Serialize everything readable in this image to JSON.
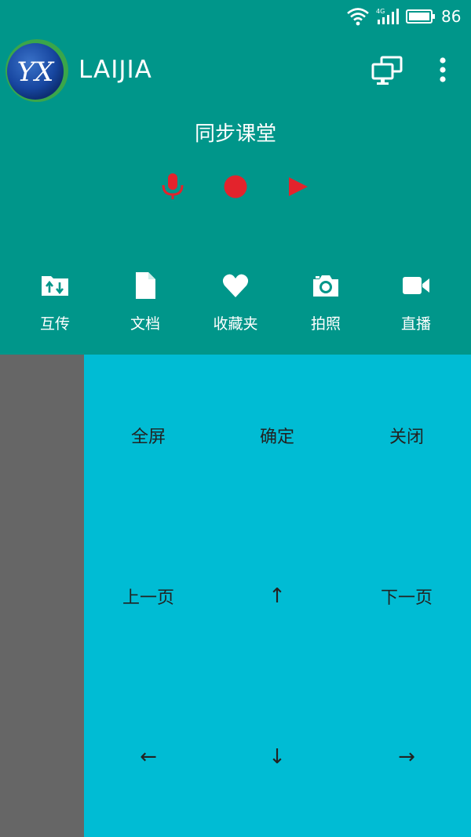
{
  "status_bar": {
    "battery_text": "86",
    "network_label": "4G"
  },
  "app_bar": {
    "title": "LAIJIA",
    "logo_text": "YX"
  },
  "classroom": {
    "title": "同步课堂"
  },
  "toolbar": {
    "items": [
      {
        "label": "互传",
        "icon": "transfer-folder-icon"
      },
      {
        "label": "文档",
        "icon": "document-icon"
      },
      {
        "label": "收藏夹",
        "icon": "heart-icon"
      },
      {
        "label": "拍照",
        "icon": "camera-icon"
      },
      {
        "label": "直播",
        "icon": "video-camera-icon"
      }
    ]
  },
  "remote": {
    "fullscreen": "全屏",
    "confirm": "确定",
    "close": "关闭",
    "prev_page": "上一页",
    "up": "↑",
    "next_page": "下一页",
    "left": "←",
    "down": "↓",
    "right": "→"
  },
  "colors": {
    "primary": "#00968a",
    "remote_bg": "#00bcd4",
    "drawer_bg": "#666666",
    "record_red": "#e3232c"
  }
}
